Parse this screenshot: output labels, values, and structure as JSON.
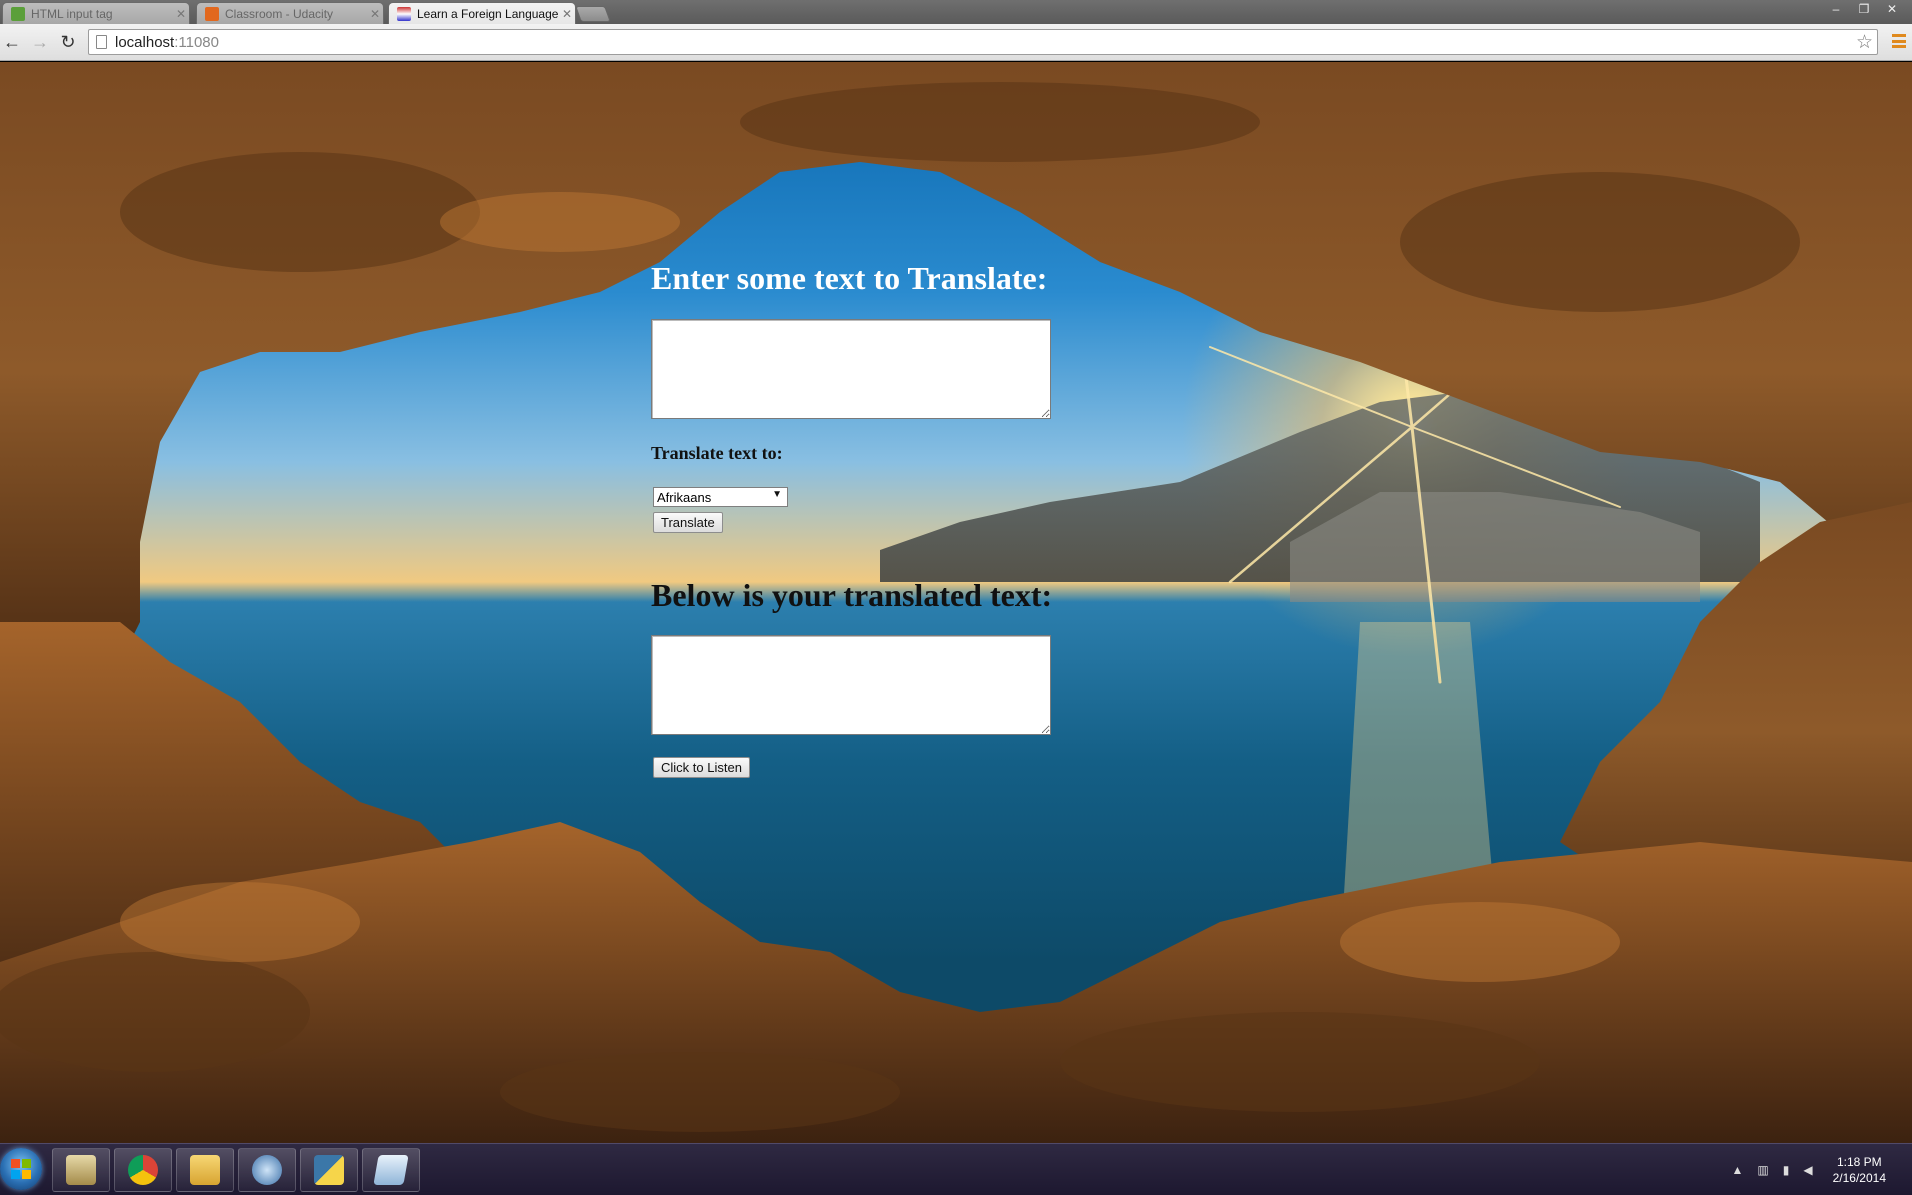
{
  "browser": {
    "tabs": [
      {
        "title": "HTML input tag",
        "active": false
      },
      {
        "title": "Classroom - Udacity",
        "active": false
      },
      {
        "title": "Learn a Foreign Language",
        "active": true
      }
    ],
    "url": {
      "host": "localhost",
      "port": ":11080"
    },
    "window_controls": {
      "minimize": "–",
      "maximize": "❐",
      "close": "✕"
    }
  },
  "page": {
    "heading_input": "Enter some text to Translate:",
    "input_value": "",
    "label_translate_to": "Translate text to:",
    "language_selected": "Afrikaans",
    "translate_button": "Translate",
    "heading_output": "Below is your translated text:",
    "output_value": "",
    "listen_button": "Click to Listen"
  },
  "taskbar": {
    "apps": [
      {
        "name": "file-cabinet-icon"
      },
      {
        "name": "chrome-icon"
      },
      {
        "name": "explorer-folder-icon"
      },
      {
        "name": "ide-icon"
      },
      {
        "name": "python-icon"
      },
      {
        "name": "notepad-icon"
      }
    ],
    "time": "1:18 PM",
    "date": "2/16/2014"
  }
}
